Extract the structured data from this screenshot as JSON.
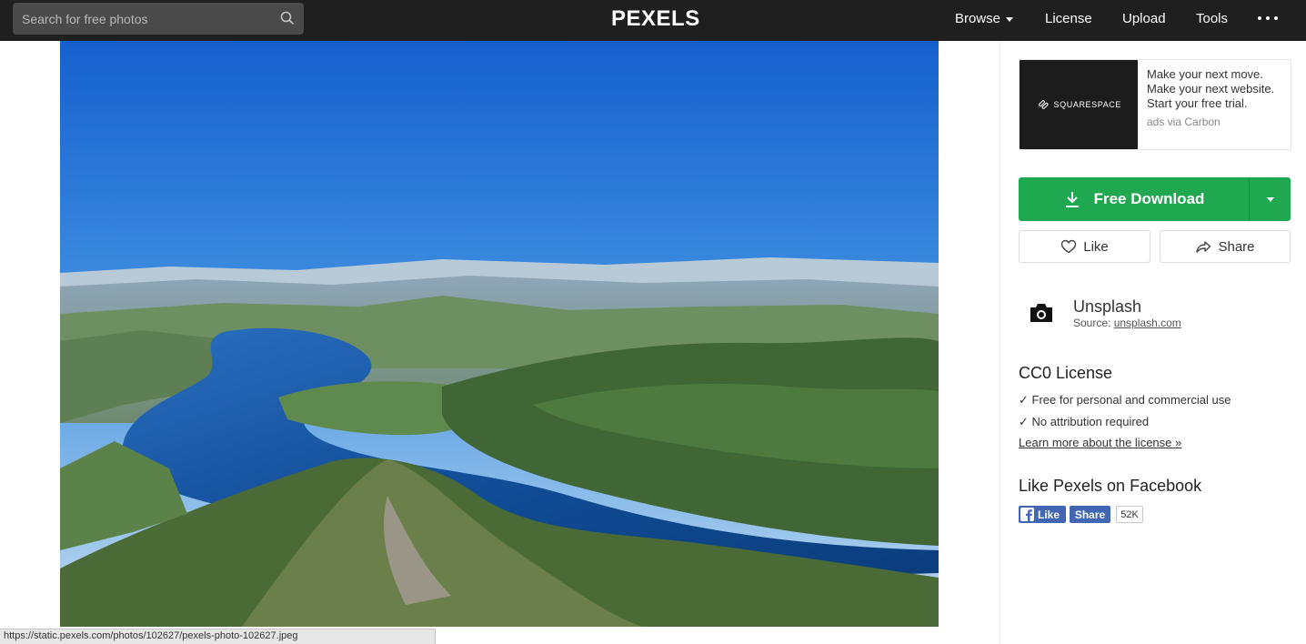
{
  "header": {
    "search": {
      "placeholder": "Search for free photos",
      "value": ""
    },
    "logo": "PEXELS",
    "nav": {
      "browse": "Browse",
      "license": "License",
      "upload": "Upload",
      "tools": "Tools"
    }
  },
  "ad": {
    "brand": "SQUARESPACE",
    "lines": [
      "Make your next move.",
      "Make your next website.",
      "Start your free trial."
    ],
    "via": "ads via Carbon"
  },
  "actions": {
    "download": "Free Download",
    "like": "Like",
    "share": "Share"
  },
  "source": {
    "name": "Unsplash",
    "label": "Source:",
    "link": "unsplash.com"
  },
  "license": {
    "title": "CC0 License",
    "items": [
      "✓ Free for personal and commercial use",
      "✓ No attribution required"
    ],
    "link": "Learn more about the license »"
  },
  "facebook": {
    "title": "Like Pexels on Facebook",
    "like": "Like",
    "share": "Share",
    "count": "52K"
  },
  "status_bar": {
    "url": "https://static.pexels.com/photos/102627/pexels-photo-102627.jpeg"
  },
  "colors": {
    "accent_green": "#1fa84f",
    "header_bg": "#1f1f1f",
    "facebook_blue": "#4267b2"
  }
}
